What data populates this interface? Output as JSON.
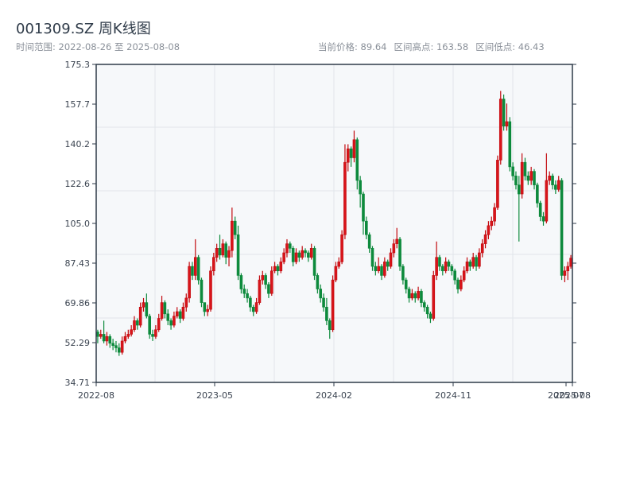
{
  "header": {
    "title": "001309.SZ 周K线图",
    "range_label": "时间范围: 2022-08-26 至 2025-08-08",
    "current_price": "当前价格: 89.64",
    "range_high": "区间高点: 163.58",
    "range_low": "区间低点: 46.43"
  },
  "chart_data": {
    "type": "candlestick",
    "title": "001309.SZ 周K线图",
    "xlabel": "",
    "ylabel": "",
    "ylim": [
      34.71,
      175.3
    ],
    "y_ticks": [
      "175.3",
      "157.7",
      "140.2",
      "122.6",
      "105.0",
      "87.43",
      "69.86",
      "52.29",
      "34.71"
    ],
    "x_ticks": [
      "2022-08",
      "2023-05",
      "2024-02",
      "2024-11",
      "2025-07",
      "2025-08"
    ],
    "grid": true,
    "colors": {
      "up": "#d8141a",
      "up_border": "#c20a0f",
      "down": "#0d8a3c",
      "background": "#f6f8fa",
      "axis": "#2e3a48",
      "grid": "#e1e5ea"
    },
    "ohlc": [
      [
        57,
        58,
        52,
        55
      ],
      [
        55,
        58,
        54,
        56
      ],
      [
        56,
        62,
        52,
        53
      ],
      [
        53,
        57,
        51,
        55
      ],
      [
        55,
        56,
        50,
        52
      ],
      [
        52,
        54,
        49,
        51
      ],
      [
        51,
        53,
        48,
        50
      ],
      [
        50,
        52,
        46.43,
        48
      ],
      [
        48,
        55,
        47,
        53
      ],
      [
        53,
        57,
        52,
        55
      ],
      [
        55,
        58,
        54,
        56
      ],
      [
        56,
        60,
        55,
        58
      ],
      [
        58,
        64,
        57,
        62
      ],
      [
        62,
        63,
        58,
        60
      ],
      [
        60,
        70,
        59,
        68
      ],
      [
        68,
        72,
        66,
        70
      ],
      [
        70,
        74,
        63,
        64
      ],
      [
        64,
        65,
        54,
        56
      ],
      [
        56,
        58,
        53,
        55
      ],
      [
        55,
        60,
        54,
        58
      ],
      [
        58,
        65,
        57,
        63
      ],
      [
        63,
        73,
        62,
        70
      ],
      [
        70,
        71,
        63,
        65
      ],
      [
        65,
        67,
        60,
        62
      ],
      [
        62,
        63,
        58,
        60
      ],
      [
        60,
        66,
        59,
        64
      ],
      [
        64,
        68,
        63,
        66
      ],
      [
        66,
        67,
        61,
        63
      ],
      [
        63,
        70,
        62,
        68
      ],
      [
        68,
        74,
        66,
        72
      ],
      [
        72,
        88,
        70,
        86
      ],
      [
        86,
        88,
        80,
        82
      ],
      [
        82,
        98,
        80,
        90
      ],
      [
        90,
        91,
        78,
        80
      ],
      [
        80,
        81,
        68,
        70
      ],
      [
        70,
        70,
        64,
        66
      ],
      [
        66,
        69,
        64,
        67
      ],
      [
        67,
        86,
        66,
        84
      ],
      [
        84,
        92,
        82,
        90
      ],
      [
        90,
        96,
        88,
        94
      ],
      [
        94,
        100,
        89,
        91
      ],
      [
        91,
        98,
        90,
        96
      ],
      [
        96,
        97,
        87,
        90
      ],
      [
        90,
        95,
        86,
        93
      ],
      [
        93,
        112,
        90,
        106
      ],
      [
        106,
        108,
        98,
        100
      ],
      [
        100,
        104,
        80,
        82
      ],
      [
        82,
        83,
        74,
        76
      ],
      [
        76,
        78,
        72,
        74
      ],
      [
        74,
        76,
        70,
        72
      ],
      [
        72,
        73,
        66,
        68
      ],
      [
        68,
        69,
        64,
        66
      ],
      [
        66,
        72,
        65,
        70
      ],
      [
        70,
        82,
        69,
        80
      ],
      [
        80,
        84,
        78,
        82
      ],
      [
        82,
        83,
        76,
        78
      ],
      [
        78,
        79,
        72,
        74
      ],
      [
        74,
        86,
        73,
        84
      ],
      [
        84,
        88,
        83,
        86
      ],
      [
        86,
        87,
        82,
        84
      ],
      [
        84,
        90,
        83,
        88
      ],
      [
        88,
        94,
        87,
        92
      ],
      [
        92,
        98,
        90,
        96
      ],
      [
        96,
        97,
        92,
        94
      ],
      [
        94,
        95,
        86,
        88
      ],
      [
        88,
        94,
        87,
        92
      ],
      [
        92,
        93,
        88,
        90
      ],
      [
        90,
        95,
        89,
        93
      ],
      [
        93,
        94,
        90,
        92
      ],
      [
        92,
        93,
        88,
        90
      ],
      [
        90,
        96,
        89,
        94
      ],
      [
        94,
        95,
        80,
        82
      ],
      [
        82,
        83,
        74,
        76
      ],
      [
        76,
        78,
        70,
        72
      ],
      [
        72,
        74,
        66,
        68
      ],
      [
        68,
        72,
        60,
        62
      ],
      [
        62,
        63,
        54,
        58
      ],
      [
        58,
        82,
        57,
        80
      ],
      [
        80,
        88,
        79,
        86
      ],
      [
        86,
        90,
        85,
        88
      ],
      [
        88,
        102,
        87,
        100
      ],
      [
        100,
        140,
        98,
        132
      ],
      [
        132,
        140,
        128,
        138
      ],
      [
        138,
        139,
        130,
        134
      ],
      [
        134,
        146,
        132,
        142
      ],
      [
        142,
        143,
        120,
        124
      ],
      [
        124,
        126,
        112,
        118
      ],
      [
        118,
        119,
        100,
        106
      ],
      [
        106,
        108,
        98,
        100
      ],
      [
        100,
        101,
        92,
        94
      ],
      [
        94,
        95,
        84,
        86
      ],
      [
        86,
        88,
        82,
        84
      ],
      [
        84,
        90,
        83,
        86
      ],
      [
        86,
        87,
        80,
        82
      ],
      [
        82,
        90,
        81,
        88
      ],
      [
        88,
        89,
        84,
        86
      ],
      [
        86,
        94,
        85,
        92
      ],
      [
        92,
        98,
        90,
        96
      ],
      [
        96,
        103,
        94,
        98
      ],
      [
        98,
        99,
        84,
        86
      ],
      [
        86,
        87,
        78,
        80
      ],
      [
        80,
        81,
        74,
        76
      ],
      [
        76,
        77,
        70,
        72
      ],
      [
        72,
        76,
        71,
        74
      ],
      [
        74,
        75,
        70,
        72
      ],
      [
        72,
        77,
        71,
        75
      ],
      [
        75,
        76,
        68,
        70
      ],
      [
        70,
        71,
        66,
        68
      ],
      [
        68,
        69,
        63,
        65
      ],
      [
        65,
        66,
        61,
        63
      ],
      [
        63,
        84,
        62,
        82
      ],
      [
        82,
        97,
        80,
        90
      ],
      [
        90,
        91,
        84,
        86
      ],
      [
        86,
        87,
        82,
        84
      ],
      [
        84,
        90,
        83,
        88
      ],
      [
        88,
        89,
        84,
        86
      ],
      [
        86,
        87,
        82,
        84
      ],
      [
        84,
        85,
        78,
        80
      ],
      [
        80,
        81,
        74,
        76
      ],
      [
        76,
        82,
        75,
        80
      ],
      [
        80,
        86,
        79,
        84
      ],
      [
        84,
        90,
        83,
        88
      ],
      [
        88,
        89,
        84,
        86
      ],
      [
        86,
        92,
        85,
        90
      ],
      [
        90,
        91,
        84,
        86
      ],
      [
        86,
        94,
        85,
        92
      ],
      [
        92,
        98,
        90,
        96
      ],
      [
        96,
        102,
        94,
        100
      ],
      [
        100,
        106,
        98,
        104
      ],
      [
        104,
        108,
        102,
        106
      ],
      [
        106,
        114,
        104,
        112
      ],
      [
        112,
        135,
        111,
        133
      ],
      [
        133,
        163.58,
        131,
        160
      ],
      [
        160,
        162,
        146,
        148
      ],
      [
        148,
        158,
        146,
        150
      ],
      [
        150,
        152,
        128,
        130
      ],
      [
        130,
        132,
        124,
        126
      ],
      [
        126,
        128,
        120,
        122
      ],
      [
        122,
        126,
        97,
        118
      ],
      [
        118,
        136,
        116,
        132
      ],
      [
        132,
        134,
        124,
        126
      ],
      [
        126,
        128,
        122,
        124
      ],
      [
        124,
        130,
        122,
        128
      ],
      [
        128,
        129,
        120,
        122
      ],
      [
        122,
        123,
        112,
        114
      ],
      [
        114,
        115,
        106,
        108
      ],
      [
        108,
        110,
        104,
        106
      ],
      [
        106,
        136,
        105,
        124
      ],
      [
        124,
        128,
        122,
        126
      ],
      [
        126,
        127,
        120,
        122
      ],
      [
        122,
        124,
        118,
        120
      ],
      [
        120,
        126,
        119,
        124
      ],
      [
        124,
        125,
        80,
        82
      ],
      [
        82,
        86,
        79,
        84
      ],
      [
        84,
        88,
        80,
        86
      ],
      [
        86,
        91,
        85,
        89.64
      ]
    ]
  }
}
